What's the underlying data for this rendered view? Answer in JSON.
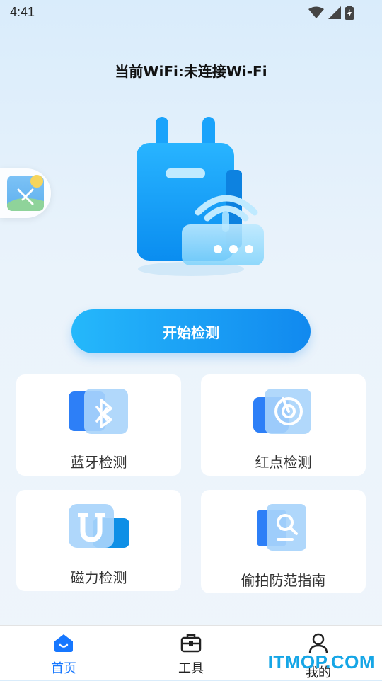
{
  "status_bar": {
    "time": "4:41"
  },
  "header": {
    "wifi_status": "当前WiFi:未连接Wi-Fi"
  },
  "main": {
    "start_button": "开始检测",
    "cards": [
      {
        "label": "蓝牙检测",
        "icon": "bluetooth-icon"
      },
      {
        "label": "红点检测",
        "icon": "radar-icon"
      },
      {
        "label": "磁力检测",
        "icon": "magnet-icon"
      },
      {
        "label": "偷拍防范指南",
        "icon": "search-guide-icon"
      }
    ]
  },
  "tabbar": {
    "tabs": [
      {
        "label": "首页",
        "icon": "home-icon",
        "active": true
      },
      {
        "label": "工具",
        "icon": "toolbox-icon",
        "active": false
      },
      {
        "label": "我的",
        "icon": "user-icon",
        "active": false
      }
    ],
    "active_color": "#1677ff"
  },
  "watermark": "ITMOP.COM",
  "colors": {
    "accent": "#1189ef",
    "accent_light": "#25b8fb"
  }
}
